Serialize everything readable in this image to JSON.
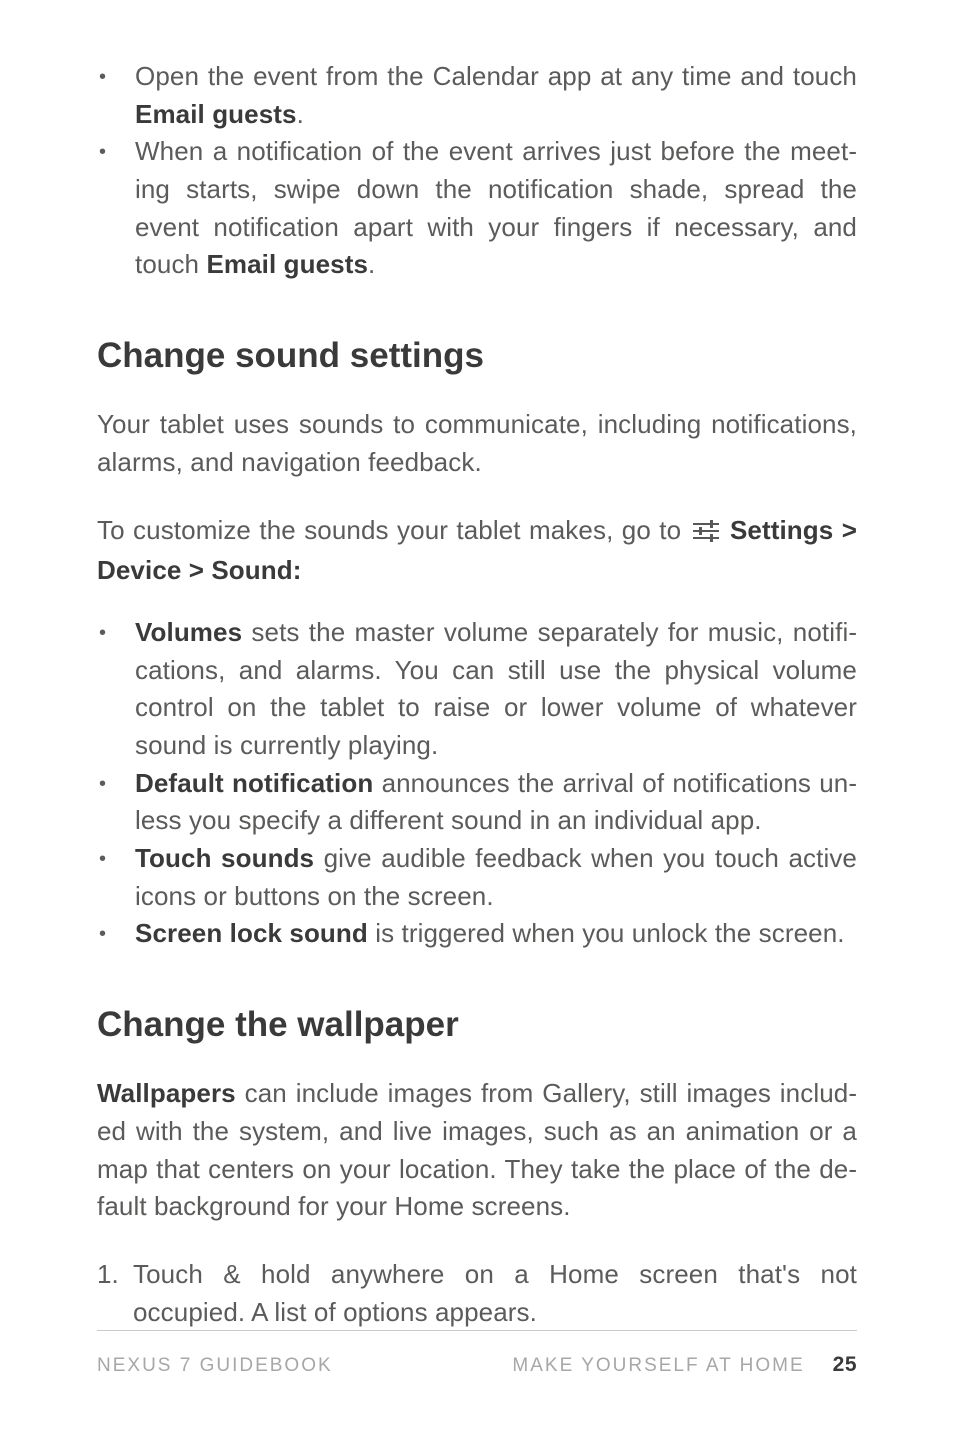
{
  "top_list": {
    "items": [
      {
        "pre": "Open the event from the Calendar app at any time and touch ",
        "bold": "Email guests",
        "post": "."
      },
      {
        "pre": "When a notification of the event arrives just before the meet­ing starts, swipe down the notification shade, spread the event notification apart with your fingers if necessary, and touch ",
        "bold": "Email guests",
        "post": "."
      }
    ]
  },
  "section1": {
    "heading": "Change sound settings",
    "para1": "Your tablet uses sounds to communicate, including notifications, alarms, and navigation feedback.",
    "para2_pre": "To customize the sounds your tablet makes, go to ",
    "para2_bold": "Settings > Device > Sound:",
    "bullets": [
      {
        "bold": "Volumes",
        "text": " sets the master volume separately for music, notifi­cations, and alarms. You can still use the physical volume con­trol on the tablet to raise or lower volume of whatever sound is currently playing."
      },
      {
        "bold": "Default notification",
        "text": " announces the arrival of notifications un­less you specify a different sound in an individual app."
      },
      {
        "bold": "Touch sounds",
        "text": " give audible feedback when you touch active icons or buttons on the screen."
      },
      {
        "bold": "Screen lock sound",
        "text": " is triggered when you unlock the screen."
      }
    ]
  },
  "section2": {
    "heading": "Change the wallpaper",
    "para_bold": "Wallpapers",
    "para_text": " can include images from Gallery, still images includ­ed with the system, and live images, such as an animation or a map that centers on your location. They take the place of the de­fault background for your Home screens.",
    "steps": [
      {
        "num": "1.",
        "text": "Touch & hold anywhere on a Home screen that's not occupied. A list of options appears."
      }
    ]
  },
  "footer": {
    "left": "NEXUS 7 GUIDEBOOK",
    "center": "MAKE YOURSELF AT HOME",
    "page": "25"
  }
}
